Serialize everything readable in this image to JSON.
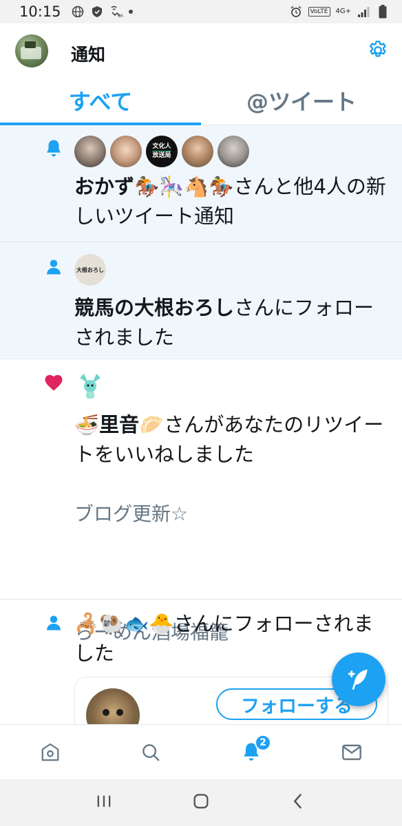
{
  "status_bar": {
    "time": "10:15",
    "network": "4G+",
    "volte": "VoLTE",
    "left_icons": [
      "globe-icon",
      "shield-icon",
      "wifi-calling-icon",
      "notification-dot"
    ],
    "right_icons": [
      "alarm-icon",
      "volte-icon",
      "signal-icon",
      "battery-icon"
    ]
  },
  "header": {
    "title": "通知",
    "settings_icon": "gear-icon"
  },
  "tabs": [
    {
      "label": "すべて",
      "active": true
    },
    {
      "label": "@ツイート",
      "active": false
    }
  ],
  "notifications": [
    {
      "type": "bell",
      "unread": true,
      "avatars": [
        "avatar-1",
        "avatar-2",
        "文化人\n放送局",
        "avatar-4",
        "avatar-5"
      ],
      "avatar3_line1": "文化人",
      "avatar3_line2": "放送局",
      "name": "おかず🏇🎠🐴🏇",
      "text": "さんと他4人の新しいツイート通知"
    },
    {
      "type": "follow",
      "unread": true,
      "avatar_text": "大根おろし",
      "name": "競馬の大根おろし",
      "text": "さんにフォローされました"
    },
    {
      "type": "like",
      "unread": false,
      "name": "🍜里音🥟",
      "text": "さんがあなたのリツイートをいいねしました",
      "preview_line1": "ブログ更新☆",
      "preview_line2": "らーめん酒場福籠",
      "preview_more": "…"
    },
    {
      "type": "follow",
      "unread": false,
      "name": "🦂🐏🐟🐣",
      "text": "さんにフォローされました",
      "follow_button": "フォローする"
    }
  ],
  "bottom_nav": {
    "items": [
      "home-icon",
      "search-icon",
      "bell-icon",
      "mail-icon"
    ],
    "badge": "2"
  },
  "fab": {
    "icon": "compose-tweet-icon"
  },
  "colors": {
    "accent": "#1da1f2",
    "like": "#e0245e",
    "unread_bg": "#f0f7fc",
    "secondary_text": "#657786"
  }
}
